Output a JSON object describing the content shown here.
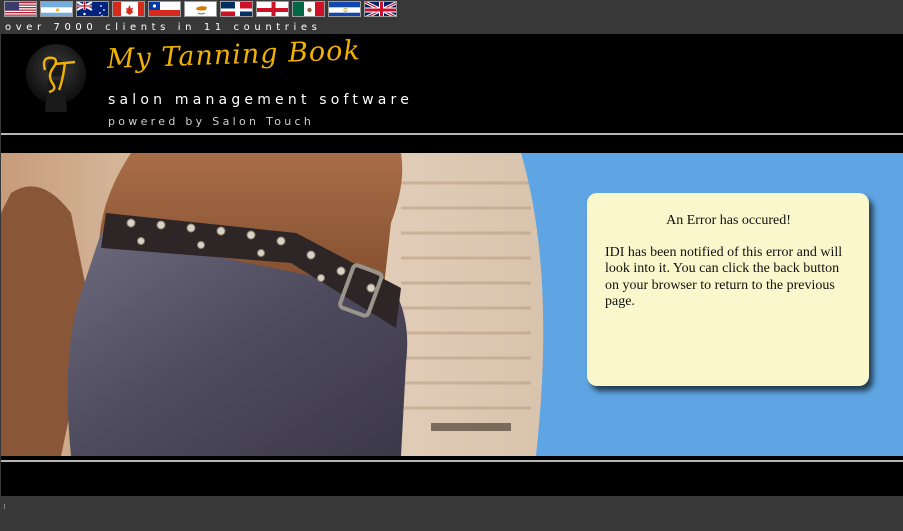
{
  "flags": [
    {
      "name": "usa-flag-icon",
      "country": "United States"
    },
    {
      "name": "argentina-flag-icon",
      "country": "Argentina"
    },
    {
      "name": "australia-flag-icon",
      "country": "Australia"
    },
    {
      "name": "canada-flag-icon",
      "country": "Canada"
    },
    {
      "name": "chile-flag-icon",
      "country": "Chile"
    },
    {
      "name": "cyprus-flag-icon",
      "country": "Cyprus"
    },
    {
      "name": "dominican-republic-flag-icon",
      "country": "Dominican Republic"
    },
    {
      "name": "england-flag-icon",
      "country": "England"
    },
    {
      "name": "mexico-flag-icon",
      "country": "Mexico"
    },
    {
      "name": "el-salvador-flag-icon",
      "country": "El Salvador"
    },
    {
      "name": "uk-flag-icon",
      "country": "United Kingdom"
    }
  ],
  "tagline": "over 7000 clients in 11 countries",
  "header": {
    "logo_monogram": "ST",
    "brand_name": "My Tanning Book",
    "subtitle": "salon management software",
    "powered_by": "powered by Salon Touch"
  },
  "error": {
    "title": "An Error has occured!",
    "message": "IDI has been notified of this error and will look into it.  You can click the back button on your browser to return to the previous page."
  },
  "colors": {
    "brand_gold": "#f0b100",
    "banner_blue": "#5fa5e3",
    "error_box_bg": "#f9f7cb",
    "page_bg": "#383838"
  }
}
